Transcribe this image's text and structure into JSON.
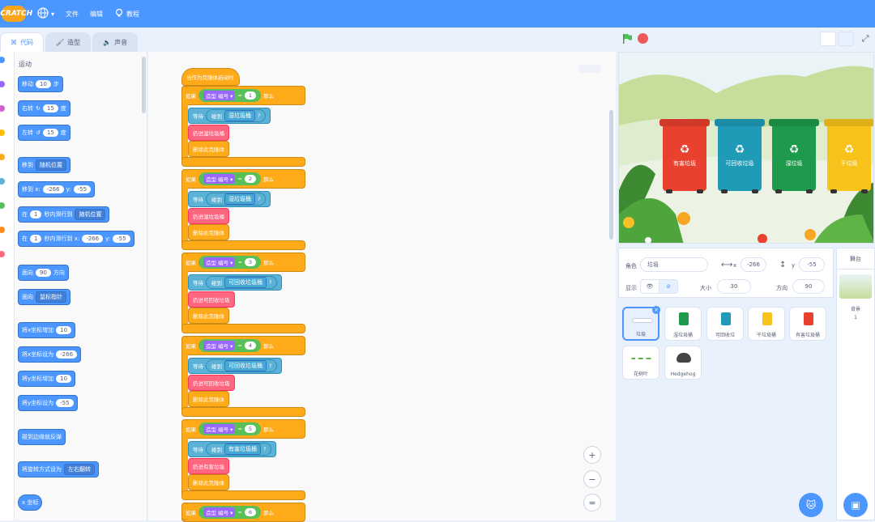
{
  "menu": {
    "logo": "SCRATCH",
    "file": "文件",
    "edit": "编辑",
    "tutorials": "教程"
  },
  "tabs": [
    {
      "label": "代码"
    },
    {
      "label": "造型"
    },
    {
      "label": "声音"
    }
  ],
  "palette": {
    "title": "运动",
    "blocks": {
      "move": "移动",
      "move_val": "10",
      "move_unit": "步",
      "turn_right": "右转",
      "turn_right_val": "15",
      "turn_right_unit": "度",
      "turn_left": "左转",
      "turn_left_val": "15",
      "turn_left_unit": "度",
      "goto": "移到",
      "goto_opt": "随机位置",
      "goto_xy": "移到 x:",
      "goto_x": "-266",
      "goto_y_label": "y:",
      "goto_y": "-55",
      "glide_in": "在",
      "glide_secs": "1",
      "glide_to": "秒内滑行到",
      "glide_opt": "随机位置",
      "glide_xy_to": "秒内滑行到 x:",
      "glide_x": "-266",
      "glide_y_label": "y:",
      "glide_y": "-55",
      "point_dir": "面向",
      "point_val": "90",
      "point_unit": "方向",
      "point_towards": "面向",
      "point_towards_opt": "鼠标指针",
      "change_x": "将x坐标增加",
      "change_x_val": "10",
      "set_x": "将x坐标设为",
      "set_x_val": "-266",
      "change_y": "将y坐标增加",
      "change_y_val": "10",
      "set_y": "将y坐标设为",
      "set_y_val": "-55",
      "bounce": "碰到边缘就反弹",
      "rotation_style": "将旋转方式设为",
      "rotation_opt": "左右翻转",
      "x_pos": "x 坐标"
    }
  },
  "script": {
    "hat": "当作为克隆体启动时",
    "if_label": "如果",
    "then_label": "那么",
    "costume": "造型",
    "costume_opt": "编号",
    "eq": "=",
    "wait_until": "等待",
    "touching": "碰到",
    "q": "?",
    "delete_clone": "删除此克隆体",
    "groups": [
      {
        "num": "1",
        "sprite": "湿垃圾桶",
        "action": "扔进湿垃圾桶"
      },
      {
        "num": "2",
        "sprite": "湿垃圾桶",
        "action": "扔进湿垃圾桶"
      },
      {
        "num": "3",
        "sprite": "可回收垃圾桶",
        "action": "扔进可回收垃圾"
      },
      {
        "num": "4",
        "sprite": "可回收垃圾桶",
        "action": "扔进可回收垃圾"
      },
      {
        "num": "5",
        "sprite": "有害垃圾桶",
        "action": "扔进有害垃圾"
      },
      {
        "num": "6"
      }
    ]
  },
  "stage": {
    "bins": [
      {
        "label": "有害垃圾",
        "color": "#e8412e"
      },
      {
        "label": "可回收垃圾",
        "color": "#1f9bb8"
      },
      {
        "label": "湿垃圾",
        "color": "#1e9a4c"
      },
      {
        "label": "干垃圾",
        "color": "#f7c21a"
      }
    ]
  },
  "sprite_info": {
    "sprite_label": "角色",
    "sprite_name": "垃圾",
    "x_label": "x",
    "x": "-266",
    "y_label": "y",
    "y": "-55",
    "show_label": "显示",
    "size_label": "大小",
    "size": "30",
    "dir_label": "方向",
    "dir": "90"
  },
  "sprites": [
    {
      "name": "垃圾",
      "color": "#ffffff"
    },
    {
      "name": "湿垃圾桶",
      "color": "#1e9a4c"
    },
    {
      "name": "可回收垃",
      "color": "#1f9bb8"
    },
    {
      "name": "干垃圾桶",
      "color": "#f7c21a"
    },
    {
      "name": "有害垃圾桶",
      "color": "#e8412e"
    },
    {
      "name": "花树叶",
      "color": "#ffffff"
    },
    {
      "name": "Hedgehog",
      "color": "#444444"
    }
  ],
  "stage_pane": {
    "title": "舞台",
    "backdrop_label": "背景",
    "backdrop_count": "1"
  },
  "zoom": {
    "in": "+",
    "out": "−",
    "reset": "="
  }
}
